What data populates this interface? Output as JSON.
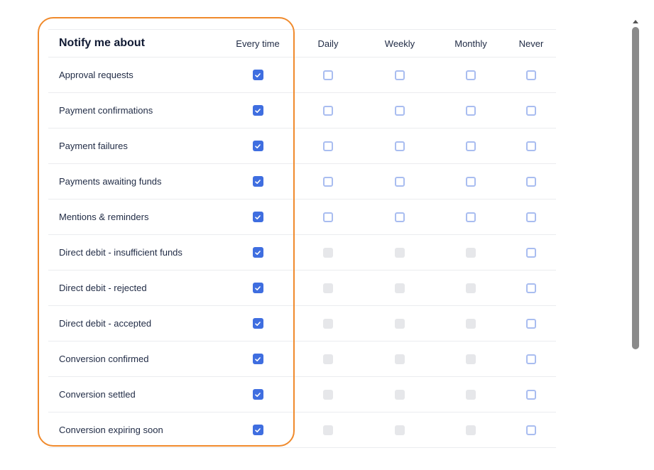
{
  "header": {
    "title": "Notify me about",
    "columns": [
      "Every time",
      "Daily",
      "Weekly",
      "Monthly",
      "Never"
    ]
  },
  "rows": [
    {
      "label": "Approval requests",
      "states": [
        "checked",
        "empty",
        "empty",
        "empty",
        "empty"
      ]
    },
    {
      "label": "Payment confirmations",
      "states": [
        "checked",
        "empty",
        "empty",
        "empty",
        "empty"
      ]
    },
    {
      "label": "Payment failures",
      "states": [
        "checked",
        "empty",
        "empty",
        "empty",
        "empty"
      ]
    },
    {
      "label": "Payments awaiting funds",
      "states": [
        "checked",
        "empty",
        "empty",
        "empty",
        "empty"
      ]
    },
    {
      "label": "Mentions & reminders",
      "states": [
        "checked",
        "empty",
        "empty",
        "empty",
        "empty"
      ]
    },
    {
      "label": "Direct debit - insufficient funds",
      "states": [
        "checked",
        "disabled",
        "disabled",
        "disabled",
        "empty"
      ]
    },
    {
      "label": "Direct debit - rejected",
      "states": [
        "checked",
        "disabled",
        "disabled",
        "disabled",
        "empty"
      ]
    },
    {
      "label": "Direct debit - accepted",
      "states": [
        "checked",
        "disabled",
        "disabled",
        "disabled",
        "empty"
      ]
    },
    {
      "label": "Conversion confirmed",
      "states": [
        "checked",
        "disabled",
        "disabled",
        "disabled",
        "empty"
      ]
    },
    {
      "label": "Conversion settled",
      "states": [
        "checked",
        "disabled",
        "disabled",
        "disabled",
        "empty"
      ]
    },
    {
      "label": "Conversion expiring soon",
      "states": [
        "checked",
        "disabled",
        "disabled",
        "disabled",
        "empty"
      ]
    }
  ],
  "colors": {
    "checked": "#3f6ee0",
    "empty_border": "#a9bdf0",
    "disabled": "#e6e7ea",
    "highlight": "#f08a2c"
  },
  "icons": {
    "check": "check-icon",
    "scroll_up": "chevron-up-icon"
  }
}
